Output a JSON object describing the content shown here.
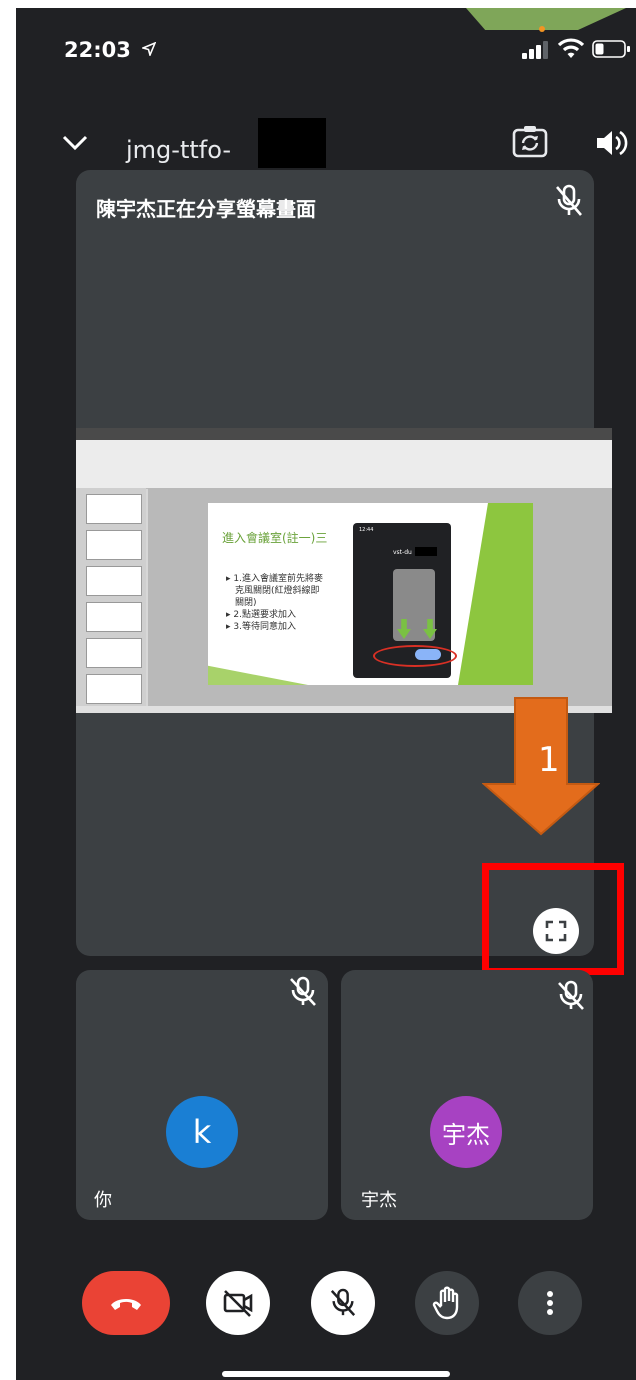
{
  "status": {
    "time": "22:03"
  },
  "top_bar": {
    "meeting_code": "jmg-ttfo-"
  },
  "presentation": {
    "caption": "陳宇杰正在分享螢幕畫面"
  },
  "slide": {
    "title": "進入會議室(註一)三",
    "bullets": [
      "1.進入會議室前先將麥",
      "克風關閉(紅燈斜線即",
      "關閉)",
      "2.點選要求加入",
      "3.等待同意加入"
    ],
    "phone_time": "12:44",
    "phone_code": "vst-du"
  },
  "annotation": {
    "step_number": "1"
  },
  "participants": [
    {
      "name": "你",
      "initial": "k",
      "color": "#1a7fd4"
    },
    {
      "name": "宇杰",
      "initial": "宇杰",
      "color": "#a742c2"
    }
  ],
  "controls": {
    "end_call_color": "#ea4335",
    "arrow_color": "#e36c1c",
    "highlight_color": "#ff0000"
  }
}
